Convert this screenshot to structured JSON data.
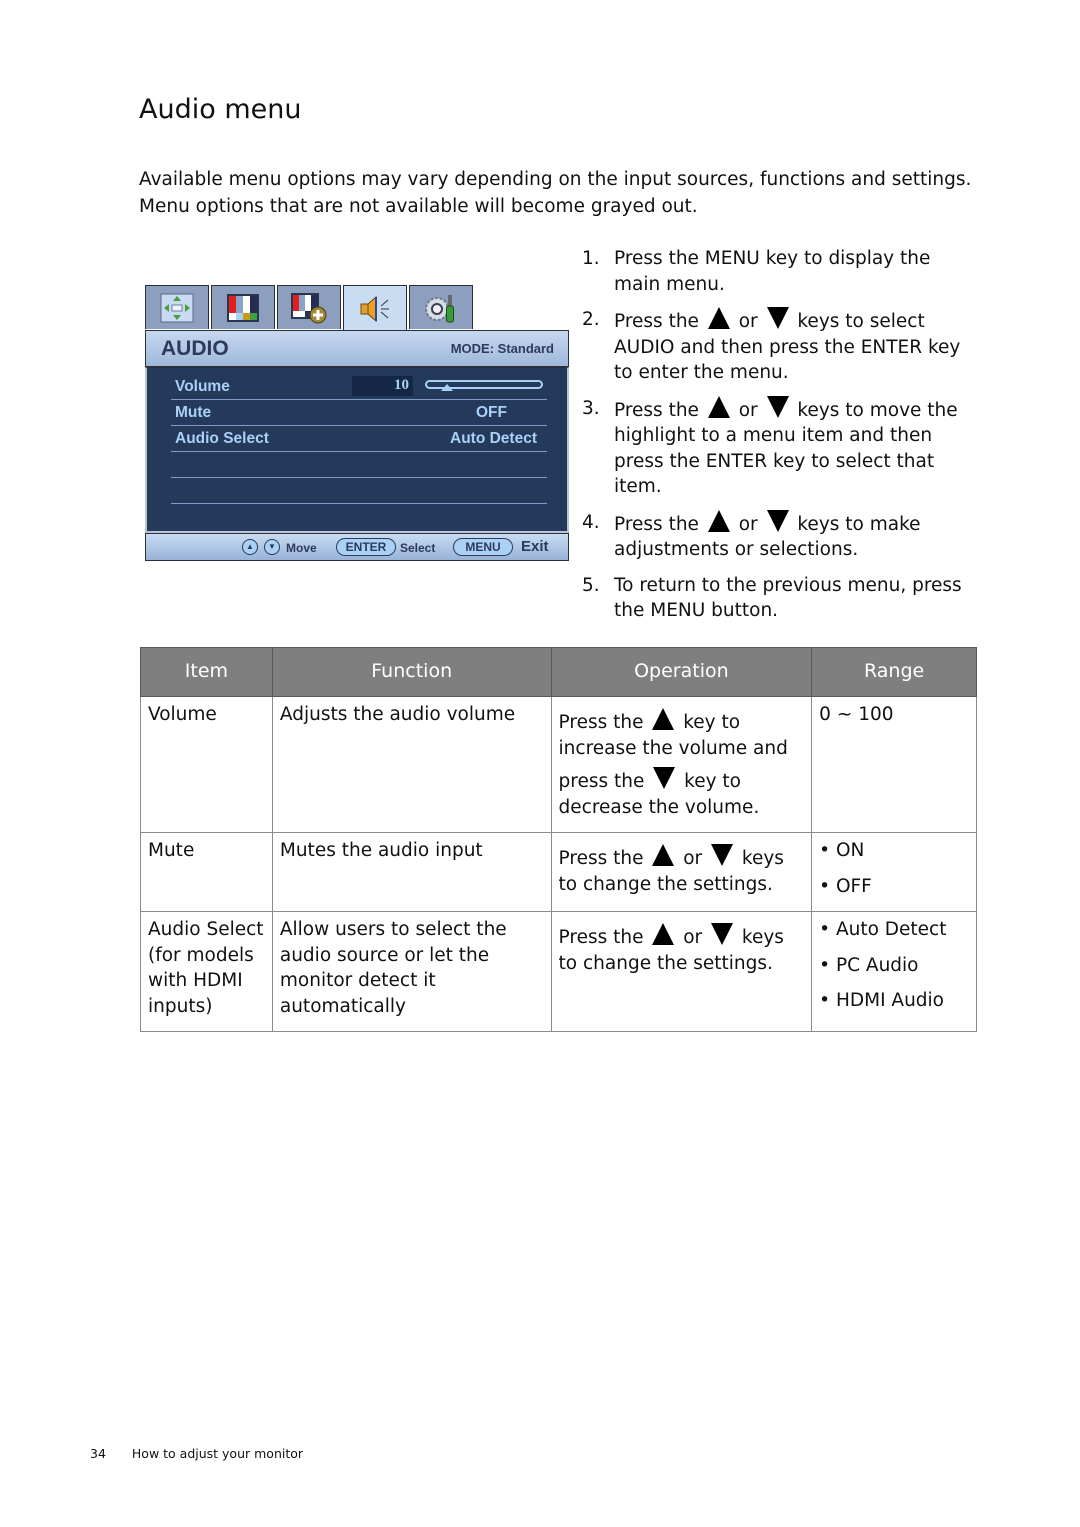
{
  "page": {
    "title": "Audio menu",
    "intro": "Available menu options may vary depending on the input sources, functions and settings. Menu options that are not available will become grayed out."
  },
  "osd": {
    "tabs": [
      {
        "icon": "display-position-icon",
        "active": false
      },
      {
        "icon": "picture-icon",
        "active": false
      },
      {
        "icon": "picture-advanced-icon",
        "active": false
      },
      {
        "icon": "speaker-icon",
        "active": true
      },
      {
        "icon": "system-settings-icon",
        "active": false
      }
    ],
    "title": "AUDIO",
    "mode": "MODE: Standard",
    "rows": [
      {
        "label": "Volume",
        "value": "10",
        "slider_fraction": 0.1
      },
      {
        "label": "Mute",
        "value": "OFF"
      },
      {
        "label": "Audio Select",
        "value": "Auto Detect"
      }
    ],
    "footer": {
      "move": "Move",
      "enter": "ENTER",
      "select": "Select",
      "menu": "MENU",
      "exit": "Exit",
      "up_glyph": "▲",
      "down_glyph": "▼"
    },
    "colors": {
      "body": "#253a5a",
      "text": "#a9d0f5",
      "header_text": "#2e3a5a"
    }
  },
  "steps": [
    {
      "num": "1.",
      "parts": [
        "Press the MENU key to display the main menu."
      ]
    },
    {
      "num": "2.",
      "parts": [
        "Press the ",
        "up",
        " or ",
        "down",
        " keys to select AUDIO and then press the ENTER key to enter the menu."
      ]
    },
    {
      "num": "3.",
      "parts": [
        "Press the ",
        "up",
        " or ",
        "down",
        " keys to move the highlight to a menu item and then press the ENTER key to select that item."
      ]
    },
    {
      "num": "4.",
      "parts": [
        "Press the ",
        "up",
        " or ",
        "down",
        " keys to make adjustments or selections."
      ]
    },
    {
      "num": "5.",
      "parts": [
        "To return to the previous menu, press the MENU button."
      ]
    }
  ],
  "table": {
    "headers": [
      "Item",
      "Function",
      "Operation",
      "Range"
    ],
    "rows": [
      {
        "item": "Volume",
        "function": "Adjusts the audio volume",
        "operation": [
          [
            "Press the ",
            "up",
            " key to increase the volume and"
          ],
          [
            "press the ",
            "down",
            " key to decrease the volume."
          ]
        ],
        "range": [
          "0 ~ 100"
        ]
      },
      {
        "item": "Mute",
        "function": "Mutes the audio input",
        "operation": [
          [
            "Press the ",
            "up",
            " or ",
            "down",
            " keys to change the settings."
          ]
        ],
        "range": [
          "• ON",
          "• OFF"
        ]
      },
      {
        "item": "Audio Select (for models with HDMI inputs)",
        "function": "Allow users to select the audio source or let the monitor detect it automatically",
        "operation": [
          [
            "Press the ",
            "up",
            " or ",
            "down",
            " keys to change the settings."
          ]
        ],
        "range": [
          "• Auto Detect",
          "• PC Audio",
          "• HDMI Audio"
        ]
      }
    ]
  },
  "footer": {
    "page_number": "34",
    "section": "How to adjust your monitor"
  }
}
